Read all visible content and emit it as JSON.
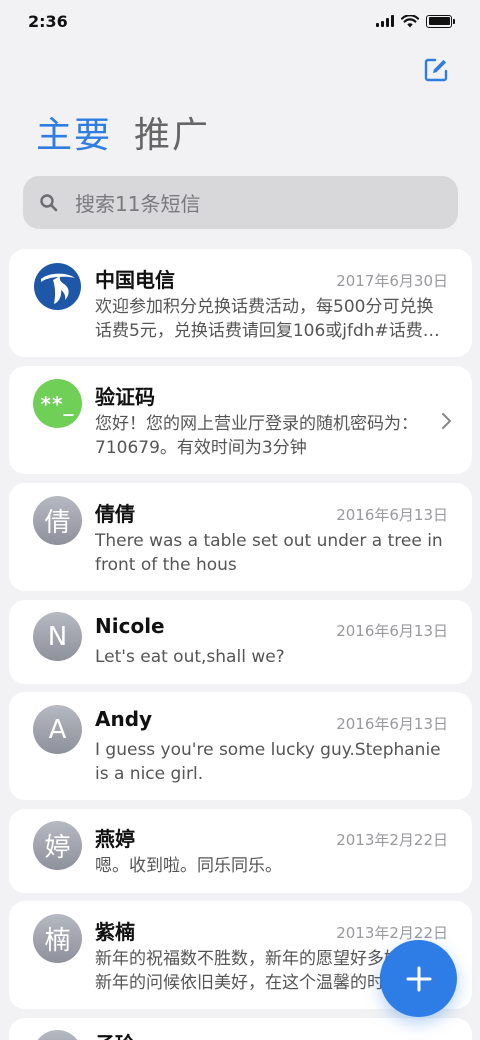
{
  "status": {
    "time": "2:36"
  },
  "tabs": {
    "primary": "主要",
    "promo": "推广"
  },
  "search": {
    "placeholder": "搜索11条短信"
  },
  "threads": [
    {
      "name": "中国电信",
      "date": "2017年6月30日",
      "message": "欢迎参加积分兑换话费活动，每500分可兑换话费5元，兑换话费请回复106或jfdh#话费…",
      "avatar": "telecom-logo"
    },
    {
      "name": "验证码",
      "date": "",
      "message": "您好！您的网上营业厅登录的随机密码为：710679。有效时间为3分钟",
      "avatar_text": "**_"
    },
    {
      "name": "倩倩",
      "date": "2016年6月13日",
      "message": "There was a table set out under a tree in front of the hous",
      "avatar_text": "倩"
    },
    {
      "name": "Nicole",
      "date": "2016年6月13日",
      "message": "Let's eat out,shall we?",
      "avatar_text": "N"
    },
    {
      "name": "Andy",
      "date": "2016年6月13日",
      "message": "I guess you're some lucky guy.Stephanie is a nice girl.",
      "avatar_text": "A"
    },
    {
      "name": "燕婷",
      "date": "2013年2月22日",
      "message": "嗯。收到啦。同乐同乐。",
      "avatar_text": "婷"
    },
    {
      "name": "紫楠",
      "date": "2013年2月22日",
      "message": "新年的祝福数不胜数，新年的愿望好多好多，新年的问候依旧美好，在这个温馨的时刻",
      "avatar_text": "楠"
    },
    {
      "name": "子玲",
      "date": "",
      "message": "",
      "avatar_text": ""
    }
  ],
  "colors": {
    "accent": "#2f7de1",
    "fab": "#2e7de6",
    "avatar_green": "#6fcf57"
  },
  "icons": [
    "compose-icon",
    "search-icon",
    "chevron-right-icon",
    "plus-icon",
    "telecom-logo-icon"
  ]
}
